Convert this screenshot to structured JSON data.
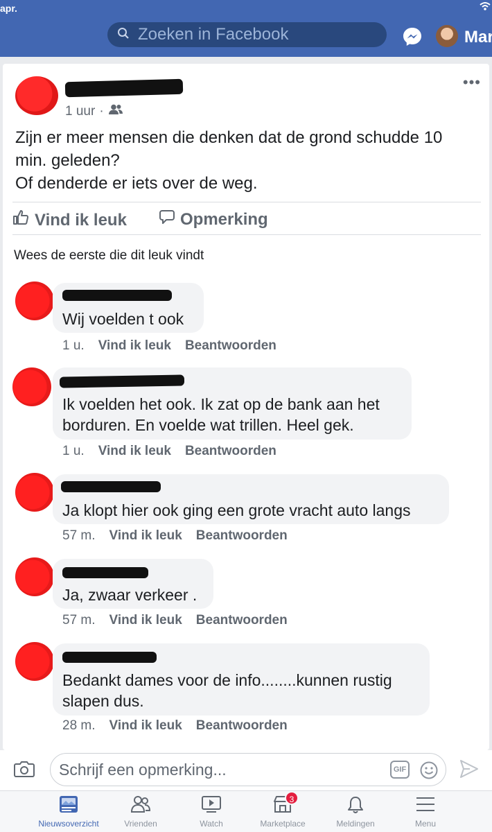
{
  "status_bar": {
    "time": "apr."
  },
  "header": {
    "search_placeholder": "Zoeken in Facebook",
    "user_name": "Mar",
    "brand_color": "#4267b2"
  },
  "post": {
    "time": "1 uur",
    "dot": "·",
    "audience_icon": "friends-icon",
    "text_lines": [
      "Zijn er meer mensen die denken dat de grond schudde 10",
      "min. geleden?",
      "Of denderde er iets over de weg."
    ],
    "like_label": "Vind ik leuk",
    "comment_label": "Opmerking",
    "first_like_text": "Wees de eerste die dit leuk vindt"
  },
  "comments": [
    {
      "lines": [
        "Wij voelden t ook"
      ],
      "time": "1 u.",
      "like": "Vind ik leuk",
      "reply": "Beantwoorden"
    },
    {
      "lines": [
        "Ik voelden het ook. Ik zat op de bank aan het",
        "borduren. En voelde wat trillen. Heel gek."
      ],
      "time": "1 u.",
      "like": "Vind ik leuk",
      "reply": "Beantwoorden"
    },
    {
      "lines": [
        "Ja klopt hier ook ging een grote vracht auto langs"
      ],
      "time": "57 m.",
      "like": "Vind ik leuk",
      "reply": "Beantwoorden"
    },
    {
      "lines": [
        "Ja, zwaar verkeer ."
      ],
      "time": "57 m.",
      "like": "Vind ik leuk",
      "reply": "Beantwoorden"
    },
    {
      "lines": [
        "Bedankt dames voor de info........kunnen rustig",
        "slapen dus."
      ],
      "time": "28 m.",
      "like": "Vind ik leuk",
      "reply": "Beantwoorden"
    }
  ],
  "composer": {
    "placeholder": "Schrijf een opmerking...",
    "gif_label": "GIF"
  },
  "bottom_nav": {
    "items": [
      {
        "label": "Nieuwsoverzicht",
        "icon": "news-feed-icon",
        "active": true
      },
      {
        "label": "Vrienden",
        "icon": "friends-icon"
      },
      {
        "label": "Watch",
        "icon": "watch-icon"
      },
      {
        "label": "Marketplace",
        "icon": "marketplace-icon",
        "badge": "3"
      },
      {
        "label": "Meldingen",
        "icon": "bell-icon"
      },
      {
        "label": "Menu",
        "icon": "menu-icon"
      }
    ]
  }
}
